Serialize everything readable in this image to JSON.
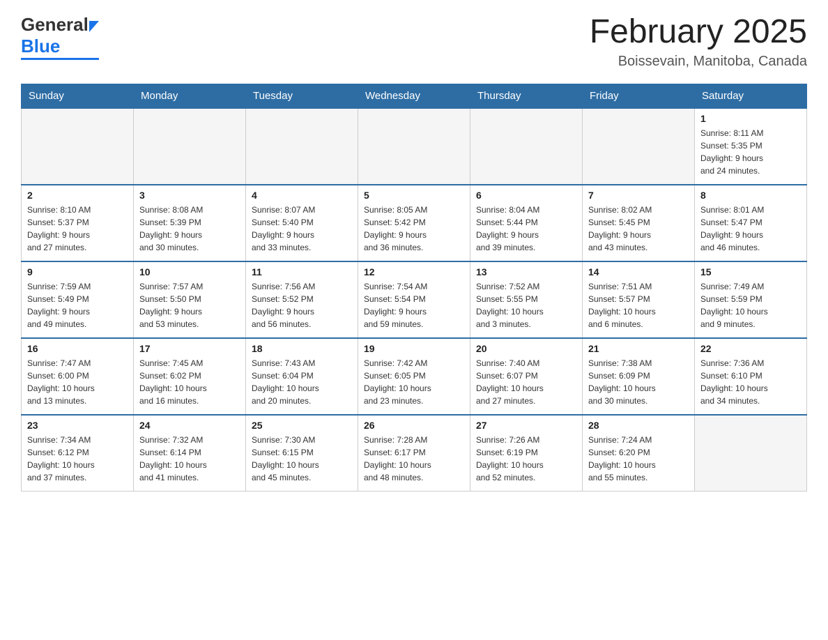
{
  "header": {
    "logo_general": "General",
    "logo_blue": "Blue",
    "title": "February 2025",
    "subtitle": "Boissevain, Manitoba, Canada"
  },
  "calendar": {
    "days_of_week": [
      "Sunday",
      "Monday",
      "Tuesday",
      "Wednesday",
      "Thursday",
      "Friday",
      "Saturday"
    ],
    "weeks": [
      [
        {
          "day": "",
          "info": "",
          "empty": true
        },
        {
          "day": "",
          "info": "",
          "empty": true
        },
        {
          "day": "",
          "info": "",
          "empty": true
        },
        {
          "day": "",
          "info": "",
          "empty": true
        },
        {
          "day": "",
          "info": "",
          "empty": true
        },
        {
          "day": "",
          "info": "",
          "empty": true
        },
        {
          "day": "1",
          "info": "Sunrise: 8:11 AM\nSunset: 5:35 PM\nDaylight: 9 hours\nand 24 minutes.",
          "empty": false
        }
      ],
      [
        {
          "day": "2",
          "info": "Sunrise: 8:10 AM\nSunset: 5:37 PM\nDaylight: 9 hours\nand 27 minutes.",
          "empty": false
        },
        {
          "day": "3",
          "info": "Sunrise: 8:08 AM\nSunset: 5:39 PM\nDaylight: 9 hours\nand 30 minutes.",
          "empty": false
        },
        {
          "day": "4",
          "info": "Sunrise: 8:07 AM\nSunset: 5:40 PM\nDaylight: 9 hours\nand 33 minutes.",
          "empty": false
        },
        {
          "day": "5",
          "info": "Sunrise: 8:05 AM\nSunset: 5:42 PM\nDaylight: 9 hours\nand 36 minutes.",
          "empty": false
        },
        {
          "day": "6",
          "info": "Sunrise: 8:04 AM\nSunset: 5:44 PM\nDaylight: 9 hours\nand 39 minutes.",
          "empty": false
        },
        {
          "day": "7",
          "info": "Sunrise: 8:02 AM\nSunset: 5:45 PM\nDaylight: 9 hours\nand 43 minutes.",
          "empty": false
        },
        {
          "day": "8",
          "info": "Sunrise: 8:01 AM\nSunset: 5:47 PM\nDaylight: 9 hours\nand 46 minutes.",
          "empty": false
        }
      ],
      [
        {
          "day": "9",
          "info": "Sunrise: 7:59 AM\nSunset: 5:49 PM\nDaylight: 9 hours\nand 49 minutes.",
          "empty": false
        },
        {
          "day": "10",
          "info": "Sunrise: 7:57 AM\nSunset: 5:50 PM\nDaylight: 9 hours\nand 53 minutes.",
          "empty": false
        },
        {
          "day": "11",
          "info": "Sunrise: 7:56 AM\nSunset: 5:52 PM\nDaylight: 9 hours\nand 56 minutes.",
          "empty": false
        },
        {
          "day": "12",
          "info": "Sunrise: 7:54 AM\nSunset: 5:54 PM\nDaylight: 9 hours\nand 59 minutes.",
          "empty": false
        },
        {
          "day": "13",
          "info": "Sunrise: 7:52 AM\nSunset: 5:55 PM\nDaylight: 10 hours\nand 3 minutes.",
          "empty": false
        },
        {
          "day": "14",
          "info": "Sunrise: 7:51 AM\nSunset: 5:57 PM\nDaylight: 10 hours\nand 6 minutes.",
          "empty": false
        },
        {
          "day": "15",
          "info": "Sunrise: 7:49 AM\nSunset: 5:59 PM\nDaylight: 10 hours\nand 9 minutes.",
          "empty": false
        }
      ],
      [
        {
          "day": "16",
          "info": "Sunrise: 7:47 AM\nSunset: 6:00 PM\nDaylight: 10 hours\nand 13 minutes.",
          "empty": false
        },
        {
          "day": "17",
          "info": "Sunrise: 7:45 AM\nSunset: 6:02 PM\nDaylight: 10 hours\nand 16 minutes.",
          "empty": false
        },
        {
          "day": "18",
          "info": "Sunrise: 7:43 AM\nSunset: 6:04 PM\nDaylight: 10 hours\nand 20 minutes.",
          "empty": false
        },
        {
          "day": "19",
          "info": "Sunrise: 7:42 AM\nSunset: 6:05 PM\nDaylight: 10 hours\nand 23 minutes.",
          "empty": false
        },
        {
          "day": "20",
          "info": "Sunrise: 7:40 AM\nSunset: 6:07 PM\nDaylight: 10 hours\nand 27 minutes.",
          "empty": false
        },
        {
          "day": "21",
          "info": "Sunrise: 7:38 AM\nSunset: 6:09 PM\nDaylight: 10 hours\nand 30 minutes.",
          "empty": false
        },
        {
          "day": "22",
          "info": "Sunrise: 7:36 AM\nSunset: 6:10 PM\nDaylight: 10 hours\nand 34 minutes.",
          "empty": false
        }
      ],
      [
        {
          "day": "23",
          "info": "Sunrise: 7:34 AM\nSunset: 6:12 PM\nDaylight: 10 hours\nand 37 minutes.",
          "empty": false
        },
        {
          "day": "24",
          "info": "Sunrise: 7:32 AM\nSunset: 6:14 PM\nDaylight: 10 hours\nand 41 minutes.",
          "empty": false
        },
        {
          "day": "25",
          "info": "Sunrise: 7:30 AM\nSunset: 6:15 PM\nDaylight: 10 hours\nand 45 minutes.",
          "empty": false
        },
        {
          "day": "26",
          "info": "Sunrise: 7:28 AM\nSunset: 6:17 PM\nDaylight: 10 hours\nand 48 minutes.",
          "empty": false
        },
        {
          "day": "27",
          "info": "Sunrise: 7:26 AM\nSunset: 6:19 PM\nDaylight: 10 hours\nand 52 minutes.",
          "empty": false
        },
        {
          "day": "28",
          "info": "Sunrise: 7:24 AM\nSunset: 6:20 PM\nDaylight: 10 hours\nand 55 minutes.",
          "empty": false
        },
        {
          "day": "",
          "info": "",
          "empty": true
        }
      ]
    ]
  }
}
